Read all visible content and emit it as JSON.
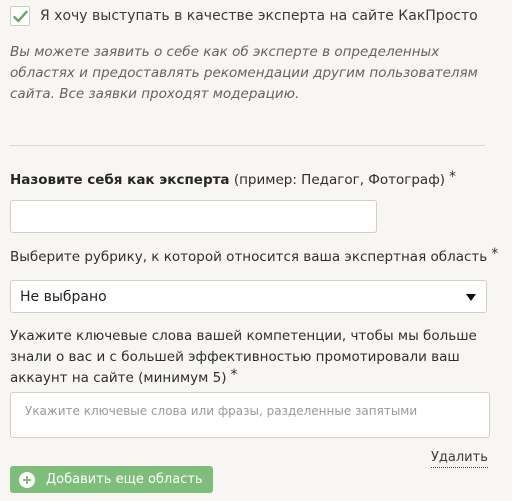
{
  "expert": {
    "checkbox_label": "Я хочу выступать в качестве эксперта на сайте КакПросто",
    "note": "Вы можете заявить о себе как об эксперте в определенных областях и предоставлять рекомендации другим пользователям сайта. Все заявки проходят модерацию."
  },
  "form": {
    "name_label_bold": "Назовите себя как эксперта",
    "name_label_hint": "(пример: Педагог, Фотограф)",
    "required_mark": "*",
    "category_label": "Выберите рубрику, к которой относится ваша экспертная область",
    "category_value": "Не выбрано",
    "keywords_label": "Укажите ключевые слова вашей компетенции, чтобы мы больше знали о вас и с большей эффективностью промотировали ваш аккаунт на сайте (минимум 5)",
    "keywords_placeholder": "Укажите ключевые слова или фразы, разделенные запятыми",
    "remove_label": "Удалить",
    "add_label": "Добавить еще область"
  },
  "colors": {
    "checkmark": "#6da66b",
    "button": "#7fbe7a",
    "background": "#f8f6f2"
  }
}
